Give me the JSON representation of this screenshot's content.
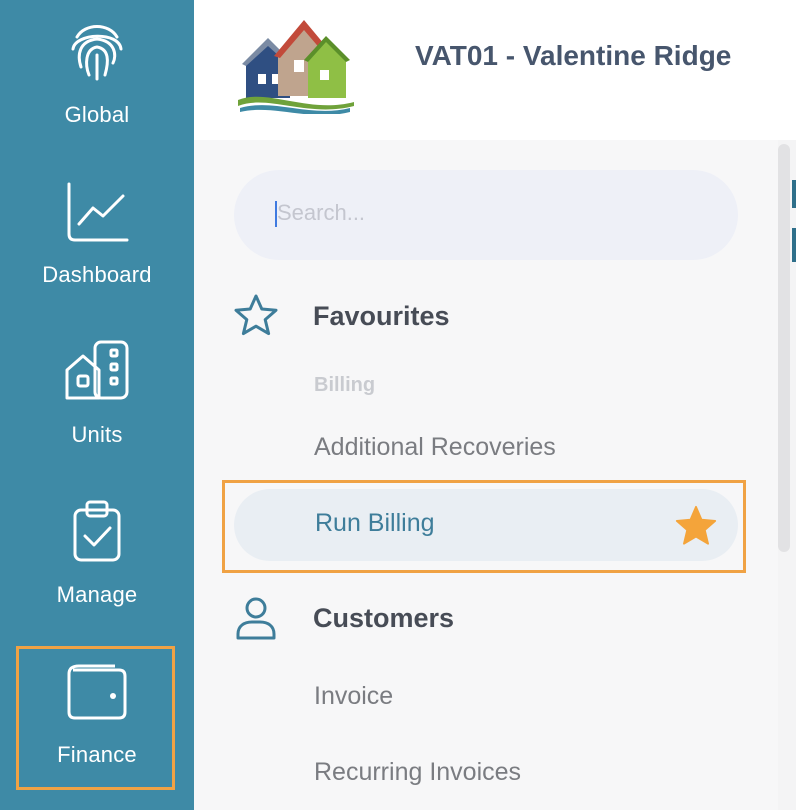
{
  "rail": {
    "items": [
      {
        "label": "Global",
        "icon": "fingerprint-icon"
      },
      {
        "label": "Dashboard",
        "icon": "line-chart-icon"
      },
      {
        "label": "Units",
        "icon": "buildings-icon"
      },
      {
        "label": "Manage",
        "icon": "clipboard-check-icon"
      },
      {
        "label": "Finance",
        "icon": "wallet-icon",
        "active": true
      }
    ],
    "color": "#3e8aa6",
    "highlight_color": "#f0a244"
  },
  "header": {
    "title": "VAT01 - Valentine Ridge"
  },
  "search": {
    "placeholder": "Search..."
  },
  "favourites": {
    "title": "Favourites",
    "group_label": "Billing",
    "items": [
      "Additional Recoveries",
      "Run Billing"
    ],
    "starred_item": "Run Billing",
    "star_color": "#f4a43a"
  },
  "customers": {
    "title": "Customers",
    "items": [
      "Invoice",
      "Recurring Invoices"
    ]
  }
}
